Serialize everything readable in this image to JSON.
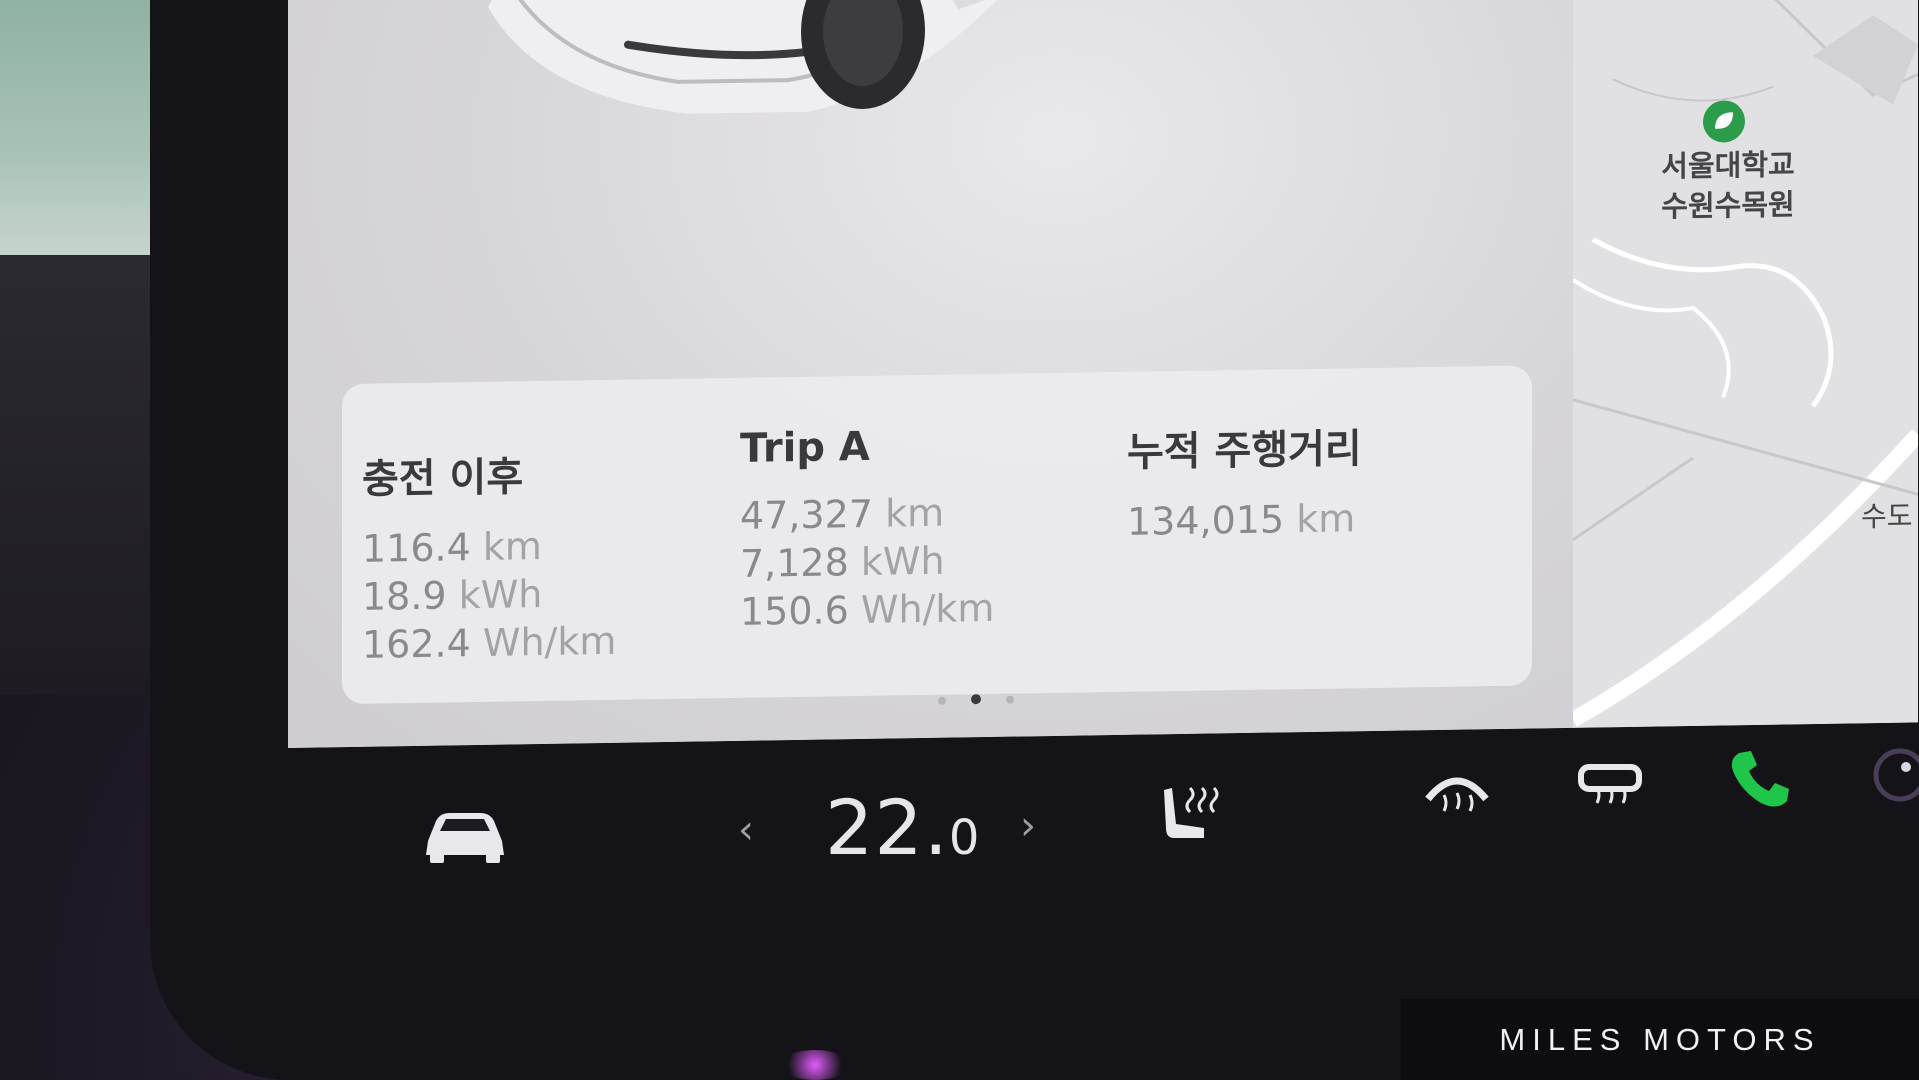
{
  "trip_card": {
    "since_charge": {
      "title": "충전 이후",
      "distance_value": "116.4",
      "distance_unit": "km",
      "energy_value": "18.9",
      "energy_unit": "kWh",
      "efficiency_value": "162.4",
      "efficiency_unit": "Wh/km"
    },
    "trip_a": {
      "title": "Trip A",
      "distance_value": "47,327",
      "distance_unit": "km",
      "energy_value": "7,128",
      "energy_unit": "kWh",
      "efficiency_value": "150.6",
      "efficiency_unit": "Wh/km"
    },
    "odometer": {
      "title": "누적 주행거리",
      "distance_value": "134,015",
      "distance_unit": "km"
    }
  },
  "page_indicator": {
    "count": 3,
    "active_index": 1
  },
  "map": {
    "poi_name_line1": "서울대학교",
    "poi_name_line2": "수원수목원",
    "edge_label": "수도",
    "poi_icon": "leaf-icon"
  },
  "climate": {
    "left_arrow": "‹",
    "temperature_whole": "22.",
    "temperature_decimal": "0",
    "right_arrow": "›"
  },
  "icons": {
    "car": "car-icon",
    "seat_heater": "seat-heater-icon",
    "front_defrost": "front-defrost-icon",
    "rear_defrost": "rear-defrost-icon",
    "phone": "phone-icon",
    "phone_color": "#1fc64a"
  },
  "watermark": {
    "text": "MILES MOTORS"
  }
}
